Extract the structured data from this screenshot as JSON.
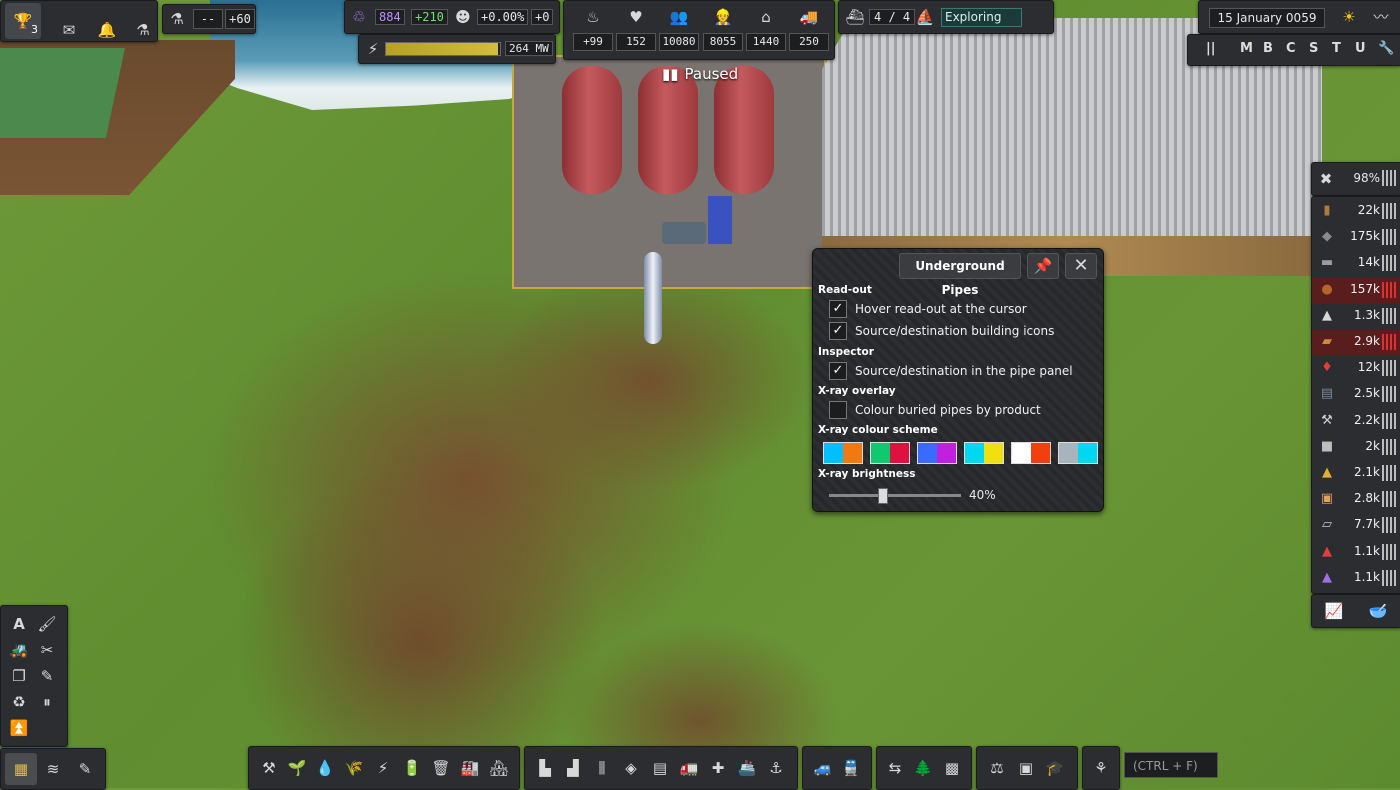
{
  "top_left": {
    "trophy_count": "3",
    "research_value": "--",
    "research_rate": "+60"
  },
  "resources_top": {
    "unity": "884",
    "unity_rate": "+210",
    "pop_growth": "+0.00%",
    "pop_delta": "+0",
    "power": "264 MW",
    "power_fraction": 0.98
  },
  "stats": [
    {
      "name": "food-icon",
      "value": "+99"
    },
    {
      "name": "health-icon",
      "value": "152"
    },
    {
      "name": "population-icon",
      "value": "10080"
    },
    {
      "name": "workers-icon",
      "value": "8055"
    },
    {
      "name": "housing-icon",
      "value": "1440"
    },
    {
      "name": "vehicles-icon",
      "value": "250"
    }
  ],
  "exploration": {
    "ships": "4 / 4",
    "status": "Exploring"
  },
  "date": "15 January 0059",
  "toolbox_letters": [
    "M",
    "B",
    "C",
    "S",
    "T",
    "U"
  ],
  "paused_label": "Paused",
  "maintenance": {
    "value": "98%"
  },
  "inventory": [
    {
      "icon": "wood-icon",
      "value": "22k",
      "low": false,
      "color": "#b07a3c"
    },
    {
      "icon": "rock-icon",
      "value": "175k",
      "low": false,
      "color": "#8a8a8a"
    },
    {
      "icon": "iron-plate-icon",
      "value": "14k",
      "low": false,
      "color": "#9c9c9c"
    },
    {
      "icon": "copper-ore-icon",
      "value": "157k",
      "low": true,
      "color": "#b5652c"
    },
    {
      "icon": "construction-parts-icon",
      "value": "1.3k",
      "low": false,
      "color": "#d8d8d8"
    },
    {
      "icon": "planks-icon",
      "value": "2.9k",
      "low": true,
      "color": "#d08a3c"
    },
    {
      "icon": "fuel-icon",
      "value": "12k",
      "low": false,
      "color": "#e04030"
    },
    {
      "icon": "steel-icon",
      "value": "2.5k",
      "low": false,
      "color": "#7a8a9a"
    },
    {
      "icon": "tools-icon",
      "value": "2.2k",
      "low": false,
      "color": "#cfcfcf"
    },
    {
      "icon": "bricks-icon",
      "value": "2k",
      "low": false,
      "color": "#bdbdbd"
    },
    {
      "icon": "construction-parts-2-icon",
      "value": "2.1k",
      "low": false,
      "color": "#e0b030"
    },
    {
      "icon": "food-pack-icon",
      "value": "2.8k",
      "low": false,
      "color": "#e0a060"
    },
    {
      "icon": "concrete-slab-icon",
      "value": "7.7k",
      "low": false,
      "color": "#c8c8c8"
    },
    {
      "icon": "construction-parts-3-icon",
      "value": "1.1k",
      "low": false,
      "color": "#e04040"
    },
    {
      "icon": "construction-parts-4-icon",
      "value": "1.1k",
      "low": false,
      "color": "#a070e0"
    }
  ],
  "search": {
    "placeholder": "(CTRL + F)"
  },
  "dialog": {
    "title": "Underground Pipes",
    "sections": {
      "readout": "Read-out",
      "inspector": "Inspector",
      "xray_overlay": "X-ray overlay",
      "xray_scheme": "X-ray colour scheme",
      "xray_brightness": "X-ray brightness"
    },
    "options": {
      "hover_readout": {
        "label": "Hover read-out at the cursor",
        "checked": true
      },
      "building_icons": {
        "label": "Source/destination building icons",
        "checked": true
      },
      "pipe_panel": {
        "label": "Source/destination in the pipe panel",
        "checked": true
      },
      "colour_buried": {
        "label": "Colour buried pipes by product",
        "checked": false
      }
    },
    "schemes": [
      [
        "#00bfff",
        "#f07a10"
      ],
      [
        "#10c870",
        "#e01040"
      ],
      [
        "#3a6aff",
        "#c020e0"
      ],
      [
        "#00d8f0",
        "#f0e010"
      ],
      [
        "#ffffff",
        "#f04010"
      ],
      [
        "#a8b4bc",
        "#00d8f0"
      ]
    ],
    "brightness": {
      "value": 0.4,
      "label": "40%"
    }
  }
}
